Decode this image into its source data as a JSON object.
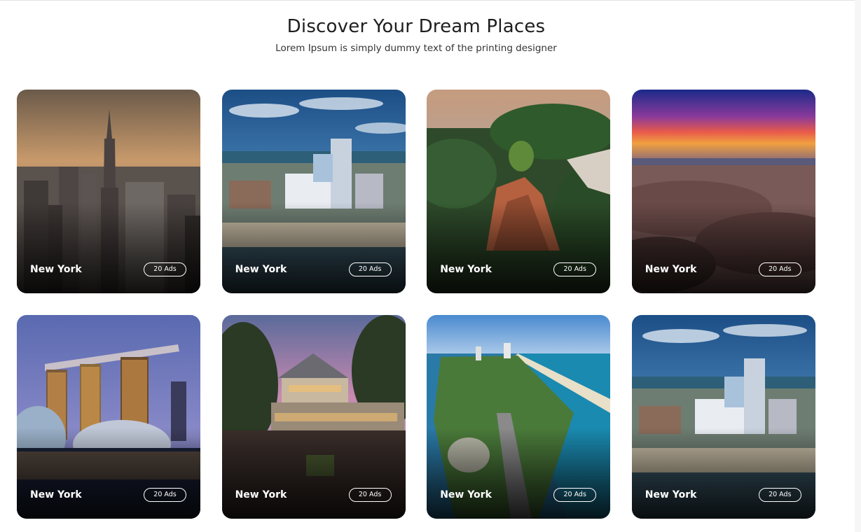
{
  "header": {
    "title": "Discover Your Dream Places",
    "subtitle": "Lorem Ipsum is simply dummy text of the printing designer"
  },
  "places": [
    {
      "name": "New York",
      "ads": "20 Ads",
      "scene": "city-skyline-image"
    },
    {
      "name": "New York",
      "ads": "20 Ads",
      "scene": "beach-resort-image"
    },
    {
      "name": "New York",
      "ads": "20 Ads",
      "scene": "canyon-forest-image"
    },
    {
      "name": "New York",
      "ads": "20 Ads",
      "scene": "desert-sunset-image"
    },
    {
      "name": "New York",
      "ads": "20 Ads",
      "scene": "marina-bay-night-image"
    },
    {
      "name": "New York",
      "ads": "20 Ads",
      "scene": "lodge-patio-image"
    },
    {
      "name": "New York",
      "ads": "20 Ads",
      "scene": "coastal-aerial-image"
    },
    {
      "name": "New York",
      "ads": "20 Ads",
      "scene": "beach-resort-image"
    }
  ]
}
